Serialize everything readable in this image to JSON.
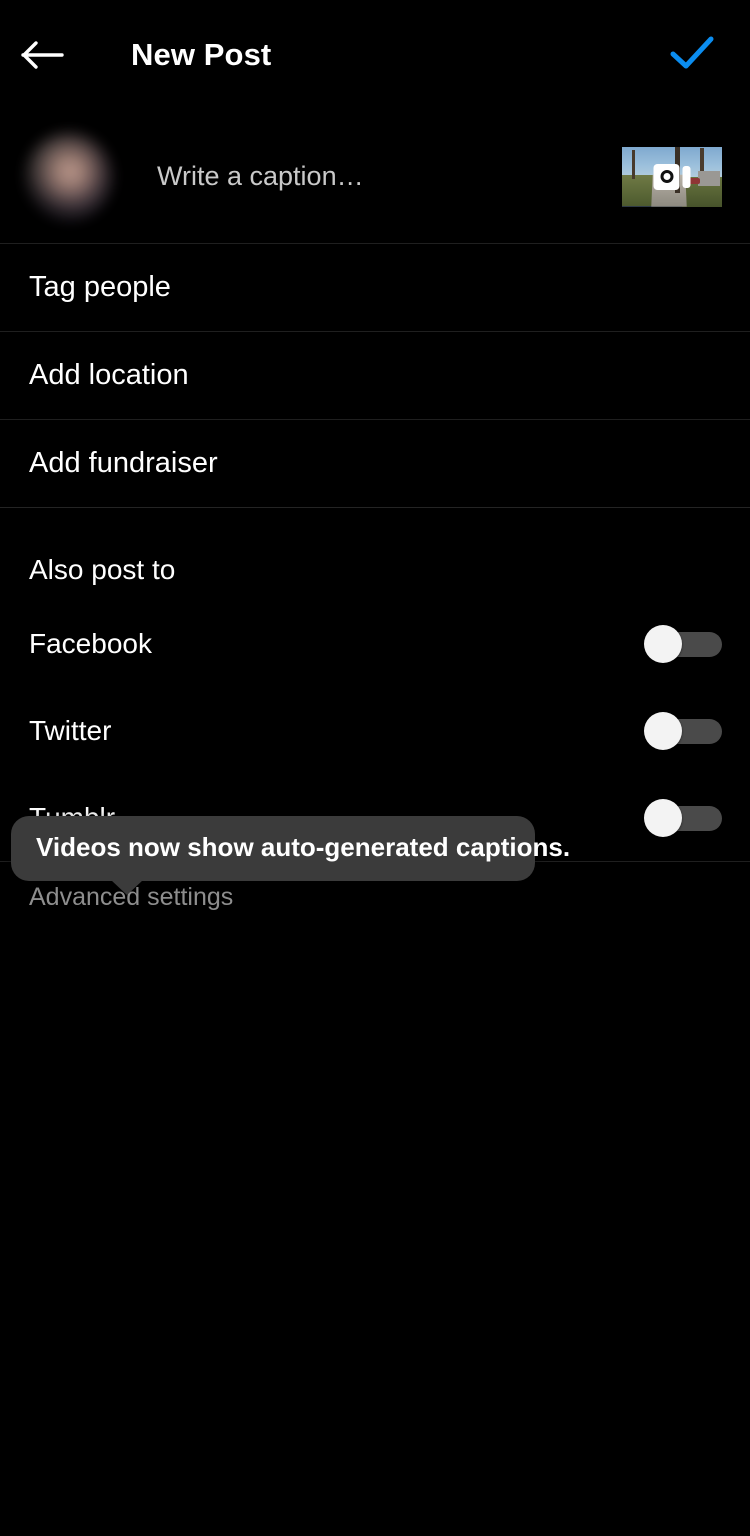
{
  "header": {
    "back_icon": "arrow-left-icon",
    "title": "New Post",
    "confirm_icon": "check-icon",
    "confirm_color": "#0b8df0"
  },
  "caption": {
    "avatar_label": "profile-avatar",
    "placeholder": "Write a caption…",
    "value": "",
    "thumbnail_label": "selected-media-thumbnail",
    "thumbnail_overlay_icon": "camera-icon"
  },
  "menu": {
    "items": [
      {
        "label": "Tag people"
      },
      {
        "label": "Add location"
      },
      {
        "label": "Add fundraiser"
      }
    ]
  },
  "also_post_to": {
    "section_title": "Also post to",
    "destinations": [
      {
        "label": "Facebook",
        "enabled": false
      },
      {
        "label": "Twitter",
        "enabled": false
      },
      {
        "label": "Tumblr",
        "enabled": false
      }
    ]
  },
  "advanced": {
    "label": "Advanced settings"
  },
  "tooltip": {
    "text": "Videos now show auto-generated captions.",
    "background": "#3b3b3b"
  },
  "theme": {
    "background": "#000000",
    "text_primary": "#ffffff",
    "text_secondary": "#8e8e8e",
    "placeholder": "#c9c9c9",
    "divider": "#1f1f1f",
    "accent": "#0b8df0",
    "switch_track_off": "#4a4a4a",
    "switch_knob": "#f3f3f3"
  }
}
